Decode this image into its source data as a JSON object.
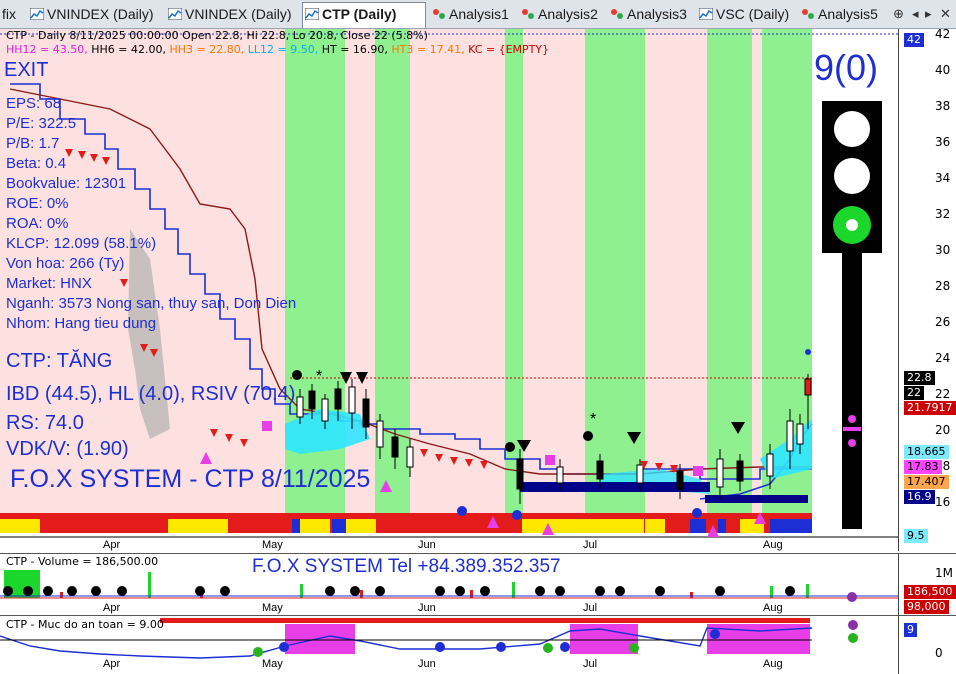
{
  "tabs": [
    {
      "label": "fix",
      "icon": "chart-icon",
      "active": false
    },
    {
      "label": "VNINDEX (Daily)",
      "icon": "chart-icon",
      "active": false
    },
    {
      "label": "VNINDEX (Daily)",
      "icon": "chart-icon",
      "active": false
    },
    {
      "label": "CTP (Daily)",
      "icon": "chart-icon",
      "active": true
    },
    {
      "label": "Analysis1",
      "icon": "analysis-icon",
      "active": false
    },
    {
      "label": "Analysis2",
      "icon": "analysis-icon",
      "active": false
    },
    {
      "label": "Analysis3",
      "icon": "analysis-icon",
      "active": false
    },
    {
      "label": "VSC (Daily)",
      "icon": "chart-icon",
      "active": false
    },
    {
      "label": "Analysis5",
      "icon": "analysis-icon",
      "active": false
    }
  ],
  "header": {
    "line1": "CTP - Daily 8/11/2025 00:00:00 Open 22.8, Hi 22.8, Lo 20.8, Close 22 (5.8%)",
    "hh12": "HH12 = 43.50,",
    "hh6": "HH6 = 42.00,",
    "hh3": "HH3 = 22.80,",
    "ll12": "LL12 = 9.50,",
    "ht": "HT = 16.90,",
    "ht3": "HT3 = 17.41,",
    "kc": "KC = {EMPTY}"
  },
  "info": {
    "exit": "EXIT",
    "lines": [
      "EPS: 68",
      "P/E: 322.5",
      "P/B: 1.7",
      "Beta: 0.4",
      "Bookvalue: 12301",
      "ROE: 0%",
      "ROA: 0%",
      "KLCP: 12.099 (58.1%)",
      "Von hoa: 266 (Ty)",
      "Market: HNX",
      "Nganh: 3573 Nong san, thuy san, Don Dien",
      "Nhom: Hang tieu dung"
    ],
    "trend": "CTP: TĂNG",
    "ibd": "IBD (44.5), HL (4.0), RSIV (70.4)",
    "rs": "RS: 74.0",
    "vdk": "VDK/V:  (1.90)",
    "banner": "F.O.X SYSTEM - CTP 8/11/2025"
  },
  "signal": {
    "score": "9(0)",
    "lights": [
      "off",
      "off",
      "green"
    ]
  },
  "price_axis": {
    "ticks": [
      "42",
      "40",
      "38",
      "36",
      "34",
      "32",
      "30",
      "28",
      "26",
      "24",
      "22",
      "20",
      "18",
      "16"
    ],
    "top_tag": "42",
    "tags": [
      {
        "text": "22.8",
        "bg": "#000000",
        "fg": "#ffffff"
      },
      {
        "text": "22",
        "bg": "#000000",
        "fg": "#ffffff"
      },
      {
        "text": "21.7917",
        "bg": "#cc0000",
        "fg": "#ffffff"
      },
      {
        "text": "18.665",
        "bg": "#7fe9ff",
        "fg": "#000000"
      },
      {
        "text": "17.83",
        "bg": "#ff44ff",
        "fg": "#000000"
      },
      {
        "text": "17.407",
        "bg": "#ffa64d",
        "fg": "#000000"
      },
      {
        "text": "16.9",
        "bg": "#000088",
        "fg": "#ffffff"
      },
      {
        "text": "9.5",
        "bg": "#7fe9ff",
        "fg": "#000000"
      }
    ]
  },
  "months": [
    "Apr",
    "May",
    "Jun",
    "Jul",
    "Aug"
  ],
  "volume": {
    "title": "CTP - Volume = 186,500.00",
    "watermark": "F.O.X SYSTEM Tel +84.389.352.357",
    "tick": "1M",
    "tag1": "186,500",
    "tag2": "98,000"
  },
  "safety": {
    "title": "CTP - Muc do an toan = 9.00",
    "tag": "9",
    "tick0": "0"
  },
  "colors": {
    "green_zone": "#8ef08e",
    "pink_zone": "#fde0e0",
    "blue_line": "#1d2fd4",
    "brown_line": "#8b1a1a"
  }
}
